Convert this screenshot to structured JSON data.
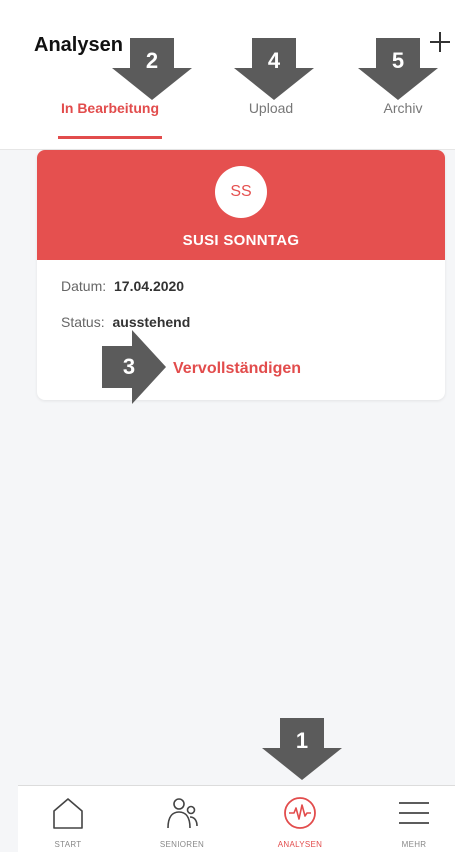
{
  "header": {
    "title": "Analysen",
    "add_icon": "plus-icon"
  },
  "tabs": [
    {
      "label": "In Bearbeitung",
      "active": true
    },
    {
      "label": "Upload",
      "active": false
    },
    {
      "label": "Archiv",
      "active": false
    }
  ],
  "card": {
    "initials": "SS",
    "name": "SUSI SONNTAG",
    "date_label": "Datum:",
    "date_value": "17.04.2020",
    "status_label": "Status:",
    "status_value": "ausstehend",
    "action_label": "Vervollständigen"
  },
  "markers": [
    "1",
    "2",
    "3",
    "4",
    "5"
  ],
  "bottom_nav": [
    {
      "label": "START",
      "icon": "home-icon"
    },
    {
      "label": "SENIOREN",
      "icon": "people-icon"
    },
    {
      "label": "ANALYSEN",
      "icon": "heartbeat-icon",
      "active": true
    },
    {
      "label": "MEHR",
      "icon": "menu-icon"
    }
  ],
  "colors": {
    "accent": "#e24c4c",
    "card_header": "#e5504f",
    "marker": "#5b5b5b",
    "background": "#f5f6f8"
  }
}
